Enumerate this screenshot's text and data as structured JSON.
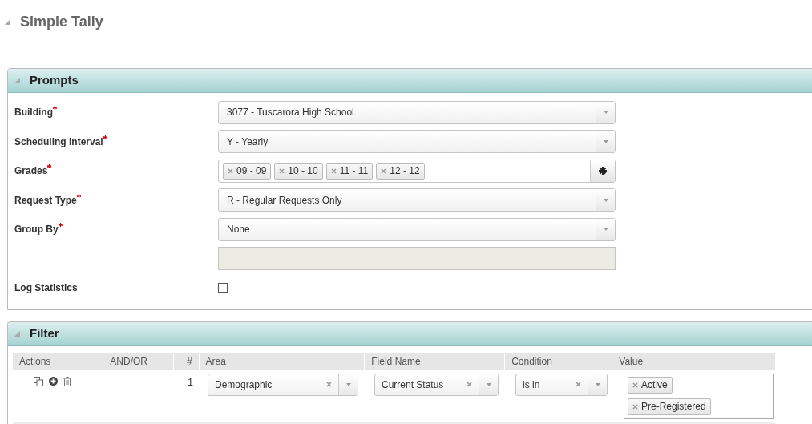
{
  "page_title": "Simple Tally",
  "prompts": {
    "title": "Prompts",
    "expanded": true,
    "fields": [
      {
        "kind": "select",
        "label": "Building",
        "required": true,
        "value": "3077 - Tuscarora High School"
      },
      {
        "kind": "select",
        "label": "Scheduling Interval",
        "required": true,
        "value": "Y - Yearly"
      },
      {
        "kind": "tags",
        "label": "Grades",
        "required": true,
        "tags": [
          "09 - 09",
          "10 - 10",
          "11 - 11",
          "12 - 12"
        ]
      },
      {
        "kind": "select",
        "label": "Request Type",
        "required": true,
        "value": "R - Regular Requests Only"
      },
      {
        "kind": "select",
        "label": "Group By",
        "required": true,
        "value": "None"
      },
      {
        "kind": "disabled_input"
      },
      {
        "kind": "checkbox",
        "label": "Log Statistics",
        "required": false,
        "checked": false
      }
    ]
  },
  "filter": {
    "title": "Filter",
    "expanded": true,
    "columns": [
      "Actions",
      "AND/OR",
      "#",
      "Area",
      "Field Name",
      "Condition",
      "Value"
    ],
    "rows": [
      {
        "number": "1",
        "area": "Demographic",
        "field_name": "Current Status",
        "condition": "is in",
        "values": [
          "Active",
          "Pre-Registered"
        ]
      }
    ]
  }
}
